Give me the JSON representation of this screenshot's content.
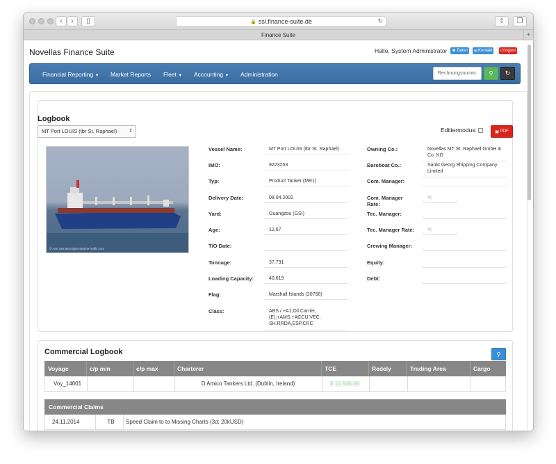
{
  "browser": {
    "url": "ssl.finance-suite.de",
    "tab_title": "Finance Suite",
    "back_icon": "chevron-left-icon",
    "forward_icon": "chevron-right-icon"
  },
  "header": {
    "app_title": "Novellas Finance Suite",
    "greeting": "Hallo, System Administrator",
    "daten_label": "Daten",
    "kontakt_label": "Kontakt",
    "logout_label": "logout"
  },
  "navbar": {
    "items": [
      {
        "label": "Financial Reporting",
        "dropdown": true
      },
      {
        "label": "Market Reports",
        "dropdown": false
      },
      {
        "label": "Fleet",
        "dropdown": true
      },
      {
        "label": "Accounting",
        "dropdown": true
      },
      {
        "label": "Administration",
        "dropdown": false
      }
    ],
    "search_placeholder": "Rechnungsnumm"
  },
  "logbook": {
    "title": "Logbook",
    "selected_vessel": "MT Port LOUIS (tbr St. Raphael)",
    "edit_mode_label": "Editiermodus:",
    "edit_mode_checked": false,
    "pdf_label": "PDF",
    "image_credit": "© Aart van Bezooijen\nMarineTraffic.com",
    "details_left": [
      {
        "label": "Vessel Name:",
        "value": "MT Port LOUIS (tbr St. Raphael)"
      },
      {
        "label": "IMO:",
        "value": "9223253"
      },
      {
        "label": "Typ:",
        "value": "Product Tanker (MR1)"
      },
      {
        "label": "Delivery Date:",
        "value": "08.04.2002"
      },
      {
        "label": "Yard:",
        "value": "Guangzou (GSI)"
      },
      {
        "label": "Age:",
        "value": "12,67"
      },
      {
        "label": "T/O Date:",
        "value": ""
      },
      {
        "label": "Tonnage:",
        "value": "37.791"
      },
      {
        "label": "Loading Capacity:",
        "value": "40.619"
      },
      {
        "label": "Flag:",
        "value": "Marshall Islands (20758)"
      },
      {
        "label": "Class:",
        "value": "ABS / +A1,Oil Carrier, (E),+AMS,+ACCU,VEC, SH,RRDA,ESP,CRC"
      }
    ],
    "details_right": [
      {
        "label": "Owning Co.:",
        "value": "Novellas MT St. Raphael GmbH & Co. KG"
      },
      {
        "label": "Bareboat Co.:",
        "value": "Sankt Georg Shipping Company Limited"
      },
      {
        "label": "Com. Manager:",
        "value": ""
      },
      {
        "label": "Com. Manager Rate:",
        "value": "%"
      },
      {
        "label": "Tec. Manager:",
        "value": ""
      },
      {
        "label": "Tec. Manager Rate:",
        "value": "%"
      },
      {
        "label": "Crewing Manager:",
        "value": ""
      },
      {
        "label": "Equity:",
        "value": ""
      },
      {
        "label": "Debt:",
        "value": ""
      }
    ]
  },
  "commercial_logbook": {
    "title": "Commercial Logbook",
    "columns": [
      "Voyage",
      "c/p min",
      "c/p max",
      "Charterer",
      "TCE",
      "Redely",
      "Trading Area",
      "Cargo"
    ],
    "rows": [
      {
        "voyage": "Voy_14001",
        "cp_min": "",
        "cp_max": "",
        "charterer": "D Amico Tankers Ltd. (Dublin, Ireland)",
        "tce": "$ 10.500,00",
        "redely": "",
        "trading_area": "",
        "cargo": ""
      }
    ]
  },
  "commercial_claims": {
    "title": "Commercial Claims",
    "rows": [
      {
        "date": "24.11.2014",
        "code": "TB",
        "description": "Speed Claim to to Missing Charts (3d; 20kUSD)"
      }
    ]
  }
}
